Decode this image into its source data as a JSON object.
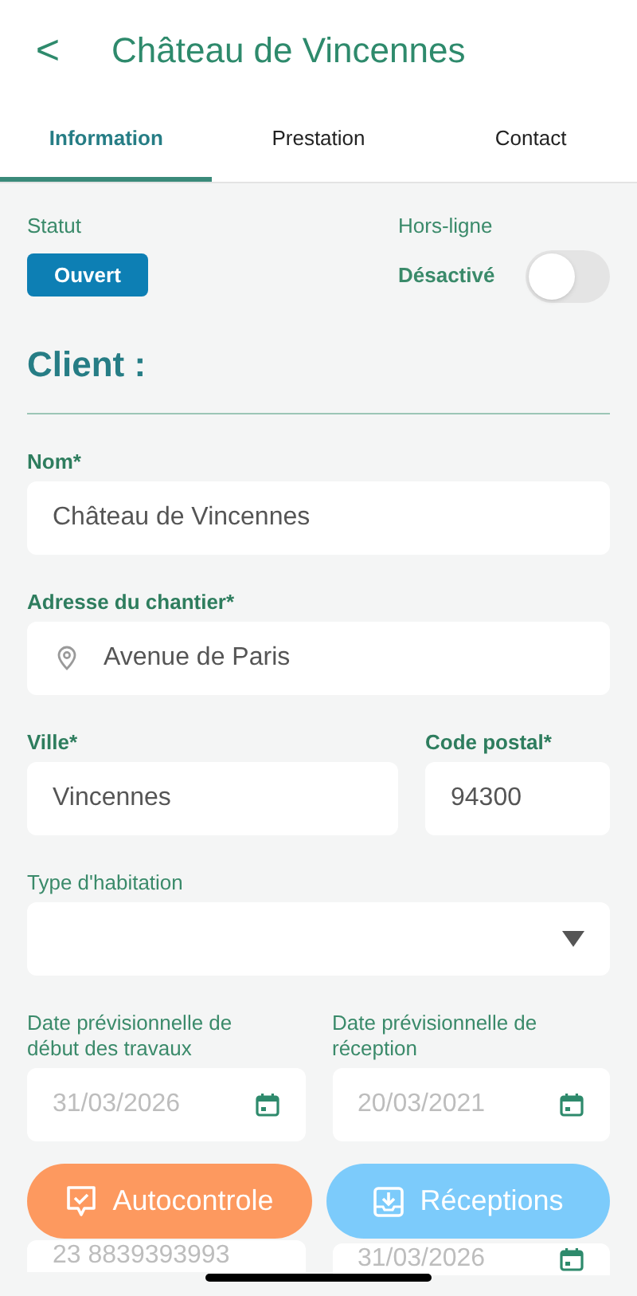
{
  "header": {
    "back": "<",
    "title": "Château de Vincennes"
  },
  "tabs": [
    {
      "label": "Information",
      "selected": true
    },
    {
      "label": "Prestation",
      "selected": false
    },
    {
      "label": "Contact",
      "selected": false
    }
  ],
  "status": {
    "label": "Statut",
    "badge": "Ouvert"
  },
  "offline": {
    "label": "Hors-ligne",
    "state_label": "Désactivé",
    "on": false
  },
  "section_title": "Client :",
  "rows": [
    [
      {
        "kind": "text",
        "label": "Nom*",
        "value": "Château de Vincennes"
      }
    ],
    [
      {
        "kind": "address",
        "label": "Adresse du chantier*",
        "value": "Avenue de Paris"
      }
    ],
    [
      {
        "kind": "text",
        "label": "Ville*",
        "value": "Vincennes"
      },
      {
        "kind": "text",
        "label": "Code postal*",
        "value": "94300"
      }
    ],
    [
      {
        "kind": "select",
        "label": "Type d'habitation"
      }
    ],
    [
      {
        "kind": "date",
        "label": "Date prévisionnelle de début des travaux",
        "placeholder": "31/03/2026"
      },
      {
        "kind": "date",
        "label": "Date prévisionnelle de réception",
        "placeholder": "20/03/2021"
      }
    ],
    [
      {
        "kind": "text",
        "placeholder": "23 8839393993"
      },
      {
        "kind": "date",
        "placeholder": "31/03/2026"
      }
    ]
  ],
  "actions": [
    {
      "kind": "check",
      "label": "Autocontrole",
      "color": "#fd995f"
    },
    {
      "kind": "inbox",
      "label": "Réceptions",
      "color": "#7ccbfb"
    }
  ]
}
